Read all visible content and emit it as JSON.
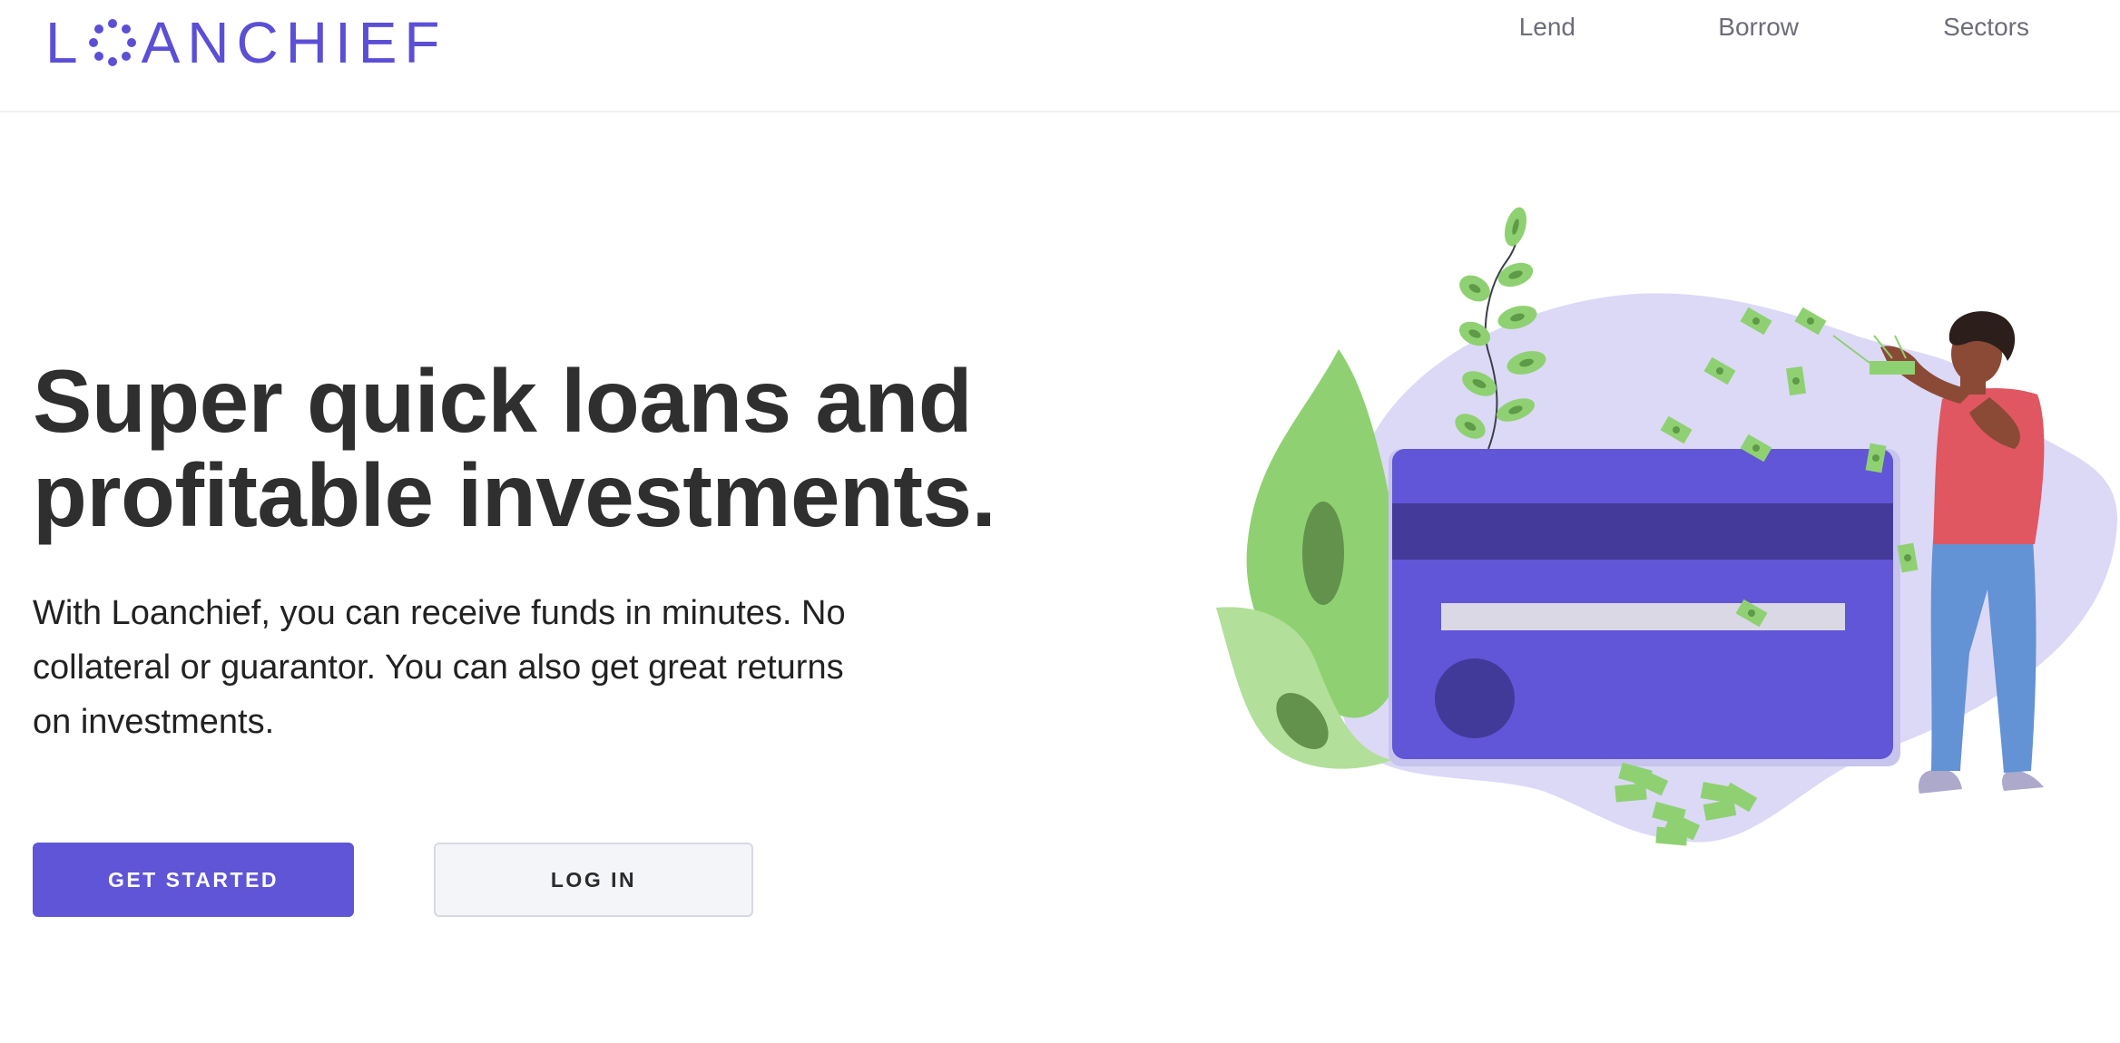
{
  "header": {
    "logo": {
      "prefix": "L",
      "suffix": "ANCHIEF",
      "mark_icon": "dotted-circle-logo-icon",
      "color": "#5b4fd6"
    },
    "nav": [
      {
        "label": "Lend"
      },
      {
        "label": "Borrow"
      },
      {
        "label": "Sectors"
      }
    ]
  },
  "hero": {
    "title": "Super quick loans and profitable investments.",
    "subtitle": "With Loanchief, you can receive funds in minutes. No collateral or guarantor. You can also get great returns on investments.",
    "primary_button": "GET STARTED",
    "secondary_button": "LOG IN",
    "accent_color": "#5f55d6"
  },
  "illustration": {
    "icon": "credit-card-person-money-illustration",
    "colors": {
      "card": "#6256d8",
      "card_stripe": "#433a9a",
      "blob": "#dddbf7",
      "leaf": "#8fd173",
      "shirt": "#e05661",
      "pants": "#6393d6"
    }
  }
}
